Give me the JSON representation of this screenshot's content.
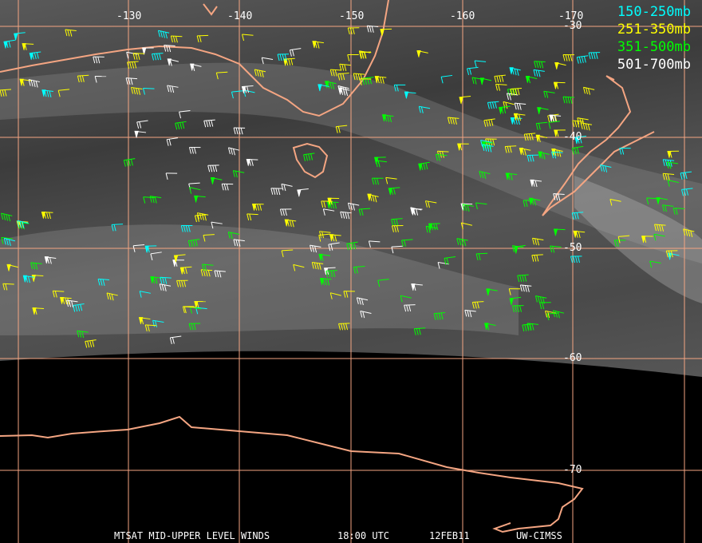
{
  "map": {
    "longitude_labels": [
      "-130",
      "-140",
      "-150",
      "-160",
      "-170"
    ],
    "latitude_labels": [
      "-30",
      "-40",
      "-50",
      "-60",
      "-70"
    ]
  },
  "legend": [
    {
      "label": "150-250mb",
      "color": "#00ffff"
    },
    {
      "label": "251-350mb",
      "color": "#ffff00"
    },
    {
      "label": "351-500mb",
      "color": "#00ff00"
    },
    {
      "label": "501-700mb",
      "color": "#ffffff"
    }
  ],
  "caption": {
    "product": "MTSAT MID-UPPER LEVEL WINDS",
    "time": "18:00 UTC",
    "date": "12FEB11",
    "source": "UW-CIMSS"
  },
  "colors": {
    "grid": "#f4a582",
    "coast": "#f4a582",
    "space": "#000000"
  }
}
